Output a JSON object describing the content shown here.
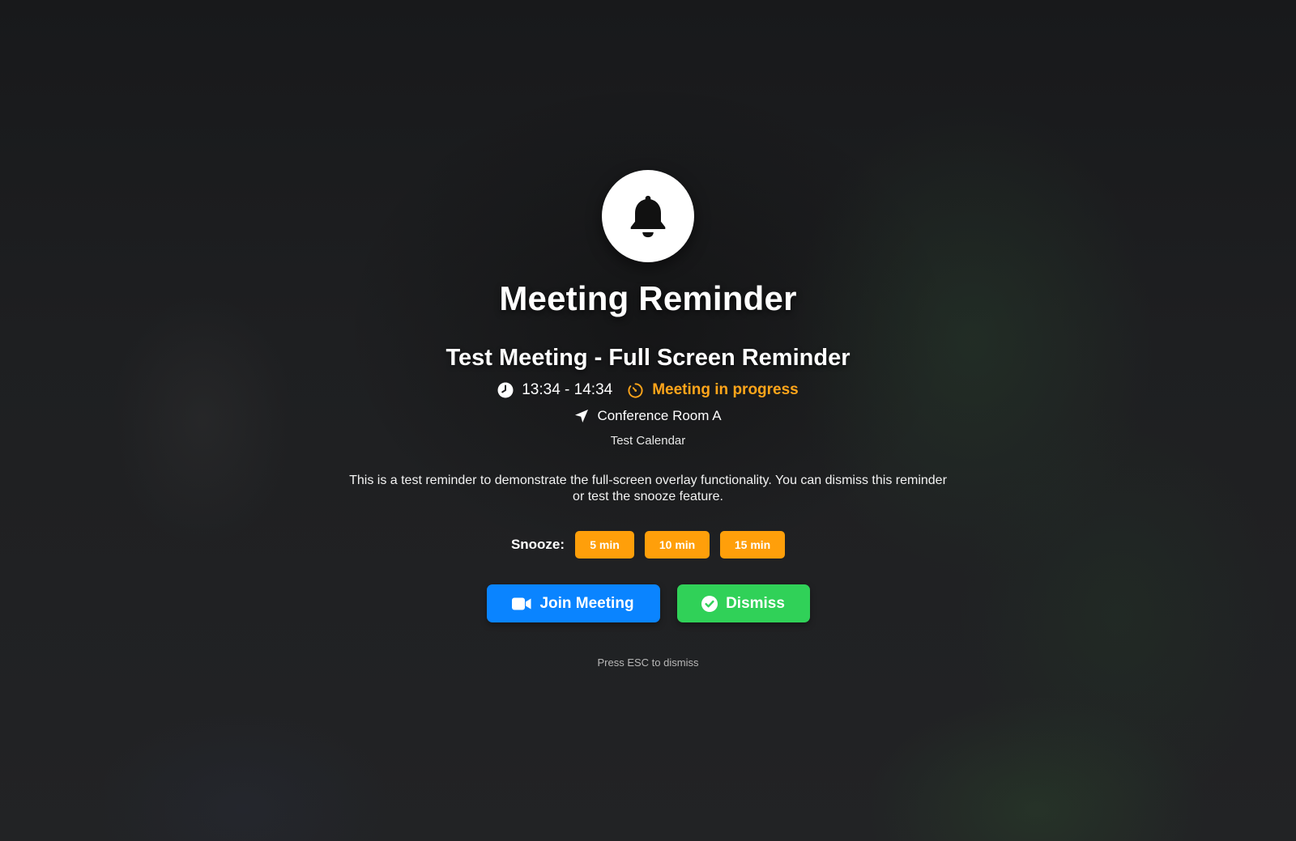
{
  "reminder": {
    "header_title": "Meeting Reminder",
    "header_icon": "bell-icon",
    "meeting_title": "Test Meeting - Full Screen Reminder",
    "time_range": "13:34 - 14:34",
    "time_icon": "clock-icon",
    "status_text": "Meeting in progress",
    "status_icon": "timer-icon",
    "location": "Conference Room A",
    "location_icon": "location-arrow-icon",
    "calendar_name": "Test Calendar",
    "description": "This is a test reminder to demonstrate the full-screen overlay functionality. You can dismiss this reminder or test the snooze feature."
  },
  "snooze": {
    "label": "Snooze:",
    "options": [
      "5 min",
      "10 min",
      "15 min"
    ]
  },
  "actions": {
    "join_label": "Join Meeting",
    "join_icon": "video-camera-icon",
    "dismiss_label": "Dismiss",
    "dismiss_icon": "check-circle-icon"
  },
  "hint": "Press ESC to dismiss",
  "colors": {
    "status_orange": "#ffa51a",
    "snooze_orange": "#ff9f0a",
    "join_blue": "#0a84ff",
    "dismiss_green": "#30d158"
  }
}
